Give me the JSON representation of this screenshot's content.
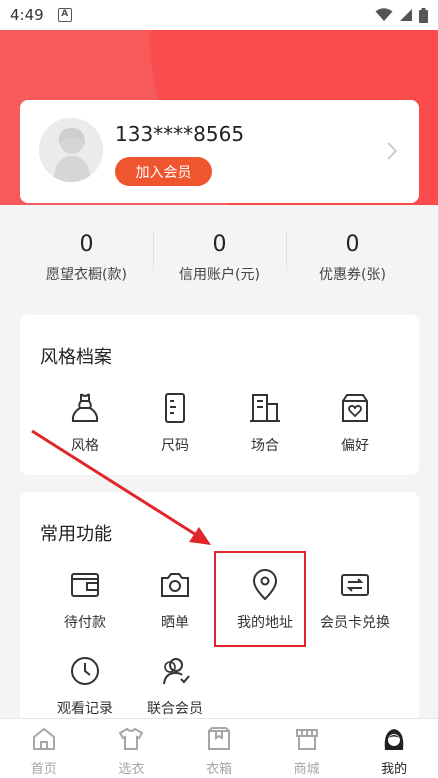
{
  "status_bar": {
    "time": "4:49",
    "notification_glyph": "A"
  },
  "profile": {
    "phone": "133****8565",
    "join_label": "加入会员"
  },
  "stats": [
    {
      "value": "0",
      "label": "愿望衣橱(款)"
    },
    {
      "value": "0",
      "label": "信用账户(元)"
    },
    {
      "value": "0",
      "label": "优惠券(张)"
    }
  ],
  "style_section": {
    "title": "风格档案",
    "items": [
      {
        "label": "风格",
        "icon": "dress-icon"
      },
      {
        "label": "尺码",
        "icon": "size-tag-icon"
      },
      {
        "label": "场合",
        "icon": "building-icon"
      },
      {
        "label": "偏好",
        "icon": "heart-box-icon"
      }
    ]
  },
  "func_section": {
    "title": "常用功能",
    "items": [
      {
        "label": "待付款",
        "icon": "wallet-icon"
      },
      {
        "label": "晒单",
        "icon": "camera-icon"
      },
      {
        "label": "我的地址",
        "icon": "location-pin-icon"
      },
      {
        "label": "会员卡兑换",
        "icon": "exchange-card-icon"
      },
      {
        "label": "观看记录",
        "icon": "clock-icon"
      },
      {
        "label": "联合会员",
        "icon": "users-icon"
      }
    ]
  },
  "bottom_nav": [
    {
      "label": "首页",
      "icon": "home-icon",
      "active": false
    },
    {
      "label": "选衣",
      "icon": "shirt-icon",
      "active": false
    },
    {
      "label": "衣箱",
      "icon": "box-icon",
      "active": false
    },
    {
      "label": "商城",
      "icon": "shop-icon",
      "active": false
    },
    {
      "label": "我的",
      "icon": "profile-avatar-icon",
      "active": true
    }
  ],
  "colors": {
    "banner": "#f65a5a",
    "accent": "#ef5630",
    "highlight": "#e0262a"
  }
}
